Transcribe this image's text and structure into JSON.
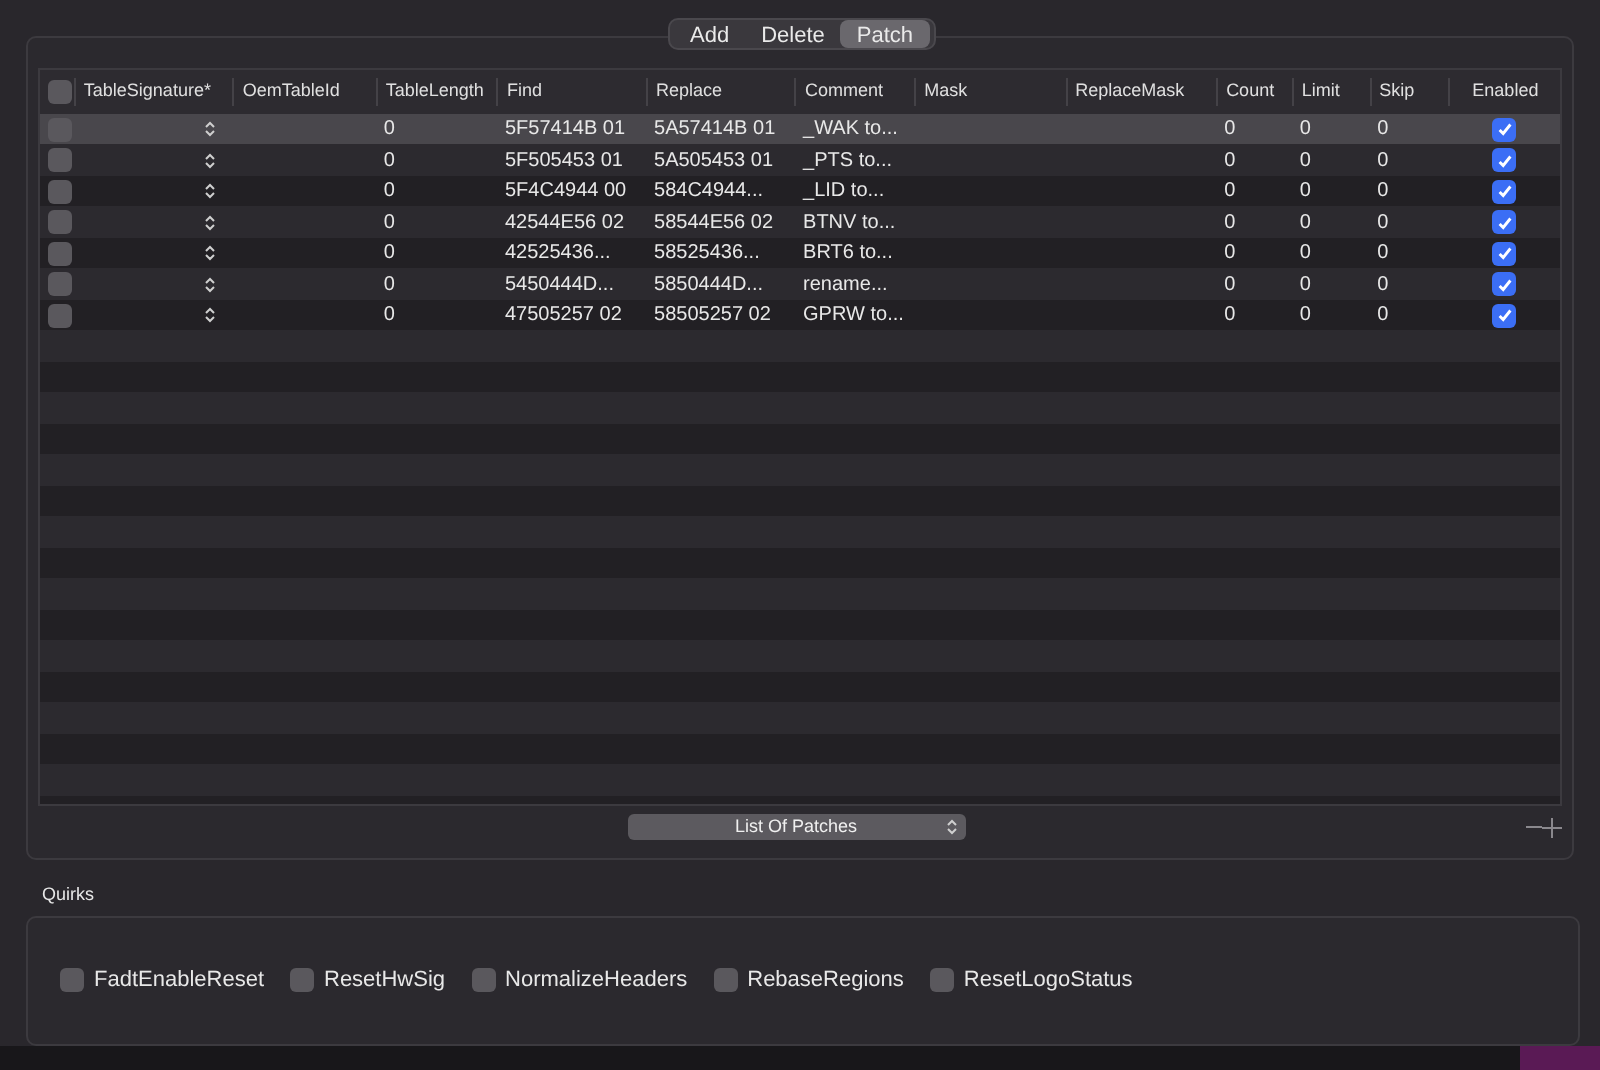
{
  "segments": [
    {
      "label": "Add",
      "selected": false
    },
    {
      "label": "Delete",
      "selected": false
    },
    {
      "label": "Patch",
      "selected": true
    }
  ],
  "table": {
    "all_checked": false,
    "columns": [
      "TableSignature*",
      "OemTableId",
      "TableLength",
      "Find",
      "Replace",
      "Comment",
      "Mask",
      "ReplaceMask",
      "Count",
      "Limit",
      "Skip",
      "Enabled"
    ],
    "rows": [
      {
        "selected": true,
        "checked": false,
        "table_length": "0",
        "find": "5F57414B 01",
        "replace": "5A57414B 01",
        "comment": "_WAK to...",
        "count": "0",
        "limit": "0",
        "skip": "0",
        "enabled": true
      },
      {
        "selected": false,
        "checked": false,
        "table_length": "0",
        "find": "5F505453 01",
        "replace": "5A505453 01",
        "comment": "_PTS to...",
        "count": "0",
        "limit": "0",
        "skip": "0",
        "enabled": true
      },
      {
        "selected": false,
        "checked": false,
        "table_length": "0",
        "find": "5F4C4944 00",
        "replace": "584C4944...",
        "comment": "_LID to...",
        "count": "0",
        "limit": "0",
        "skip": "0",
        "enabled": true
      },
      {
        "selected": false,
        "checked": false,
        "table_length": "0",
        "find": "42544E56 02",
        "replace": "58544E56 02",
        "comment": "BTNV to...",
        "count": "0",
        "limit": "0",
        "skip": "0",
        "enabled": true
      },
      {
        "selected": false,
        "checked": false,
        "table_length": "0",
        "find": "42525436...",
        "replace": "58525436...",
        "comment": "BRT6 to...",
        "count": "0",
        "limit": "0",
        "skip": "0",
        "enabled": true
      },
      {
        "selected": false,
        "checked": false,
        "table_length": "0",
        "find": "5450444D...",
        "replace": "5850444D...",
        "comment": "rename...",
        "count": "0",
        "limit": "0",
        "skip": "0",
        "enabled": true
      },
      {
        "selected": false,
        "checked": false,
        "table_length": "0",
        "find": "47505257 02",
        "replace": "58505257 02",
        "comment": "GPRW to...",
        "count": "0",
        "limit": "0",
        "skip": "0",
        "enabled": true
      }
    ]
  },
  "popup": {
    "value": "List Of Patches"
  },
  "quirks": {
    "title": "Quirks",
    "items": [
      {
        "label": "FadtEnableReset",
        "checked": false
      },
      {
        "label": "ResetHwSig",
        "checked": false
      },
      {
        "label": "NormalizeHeaders",
        "checked": false
      },
      {
        "label": "RebaseRegions",
        "checked": false
      },
      {
        "label": "ResetLogoStatus",
        "checked": false
      }
    ]
  }
}
